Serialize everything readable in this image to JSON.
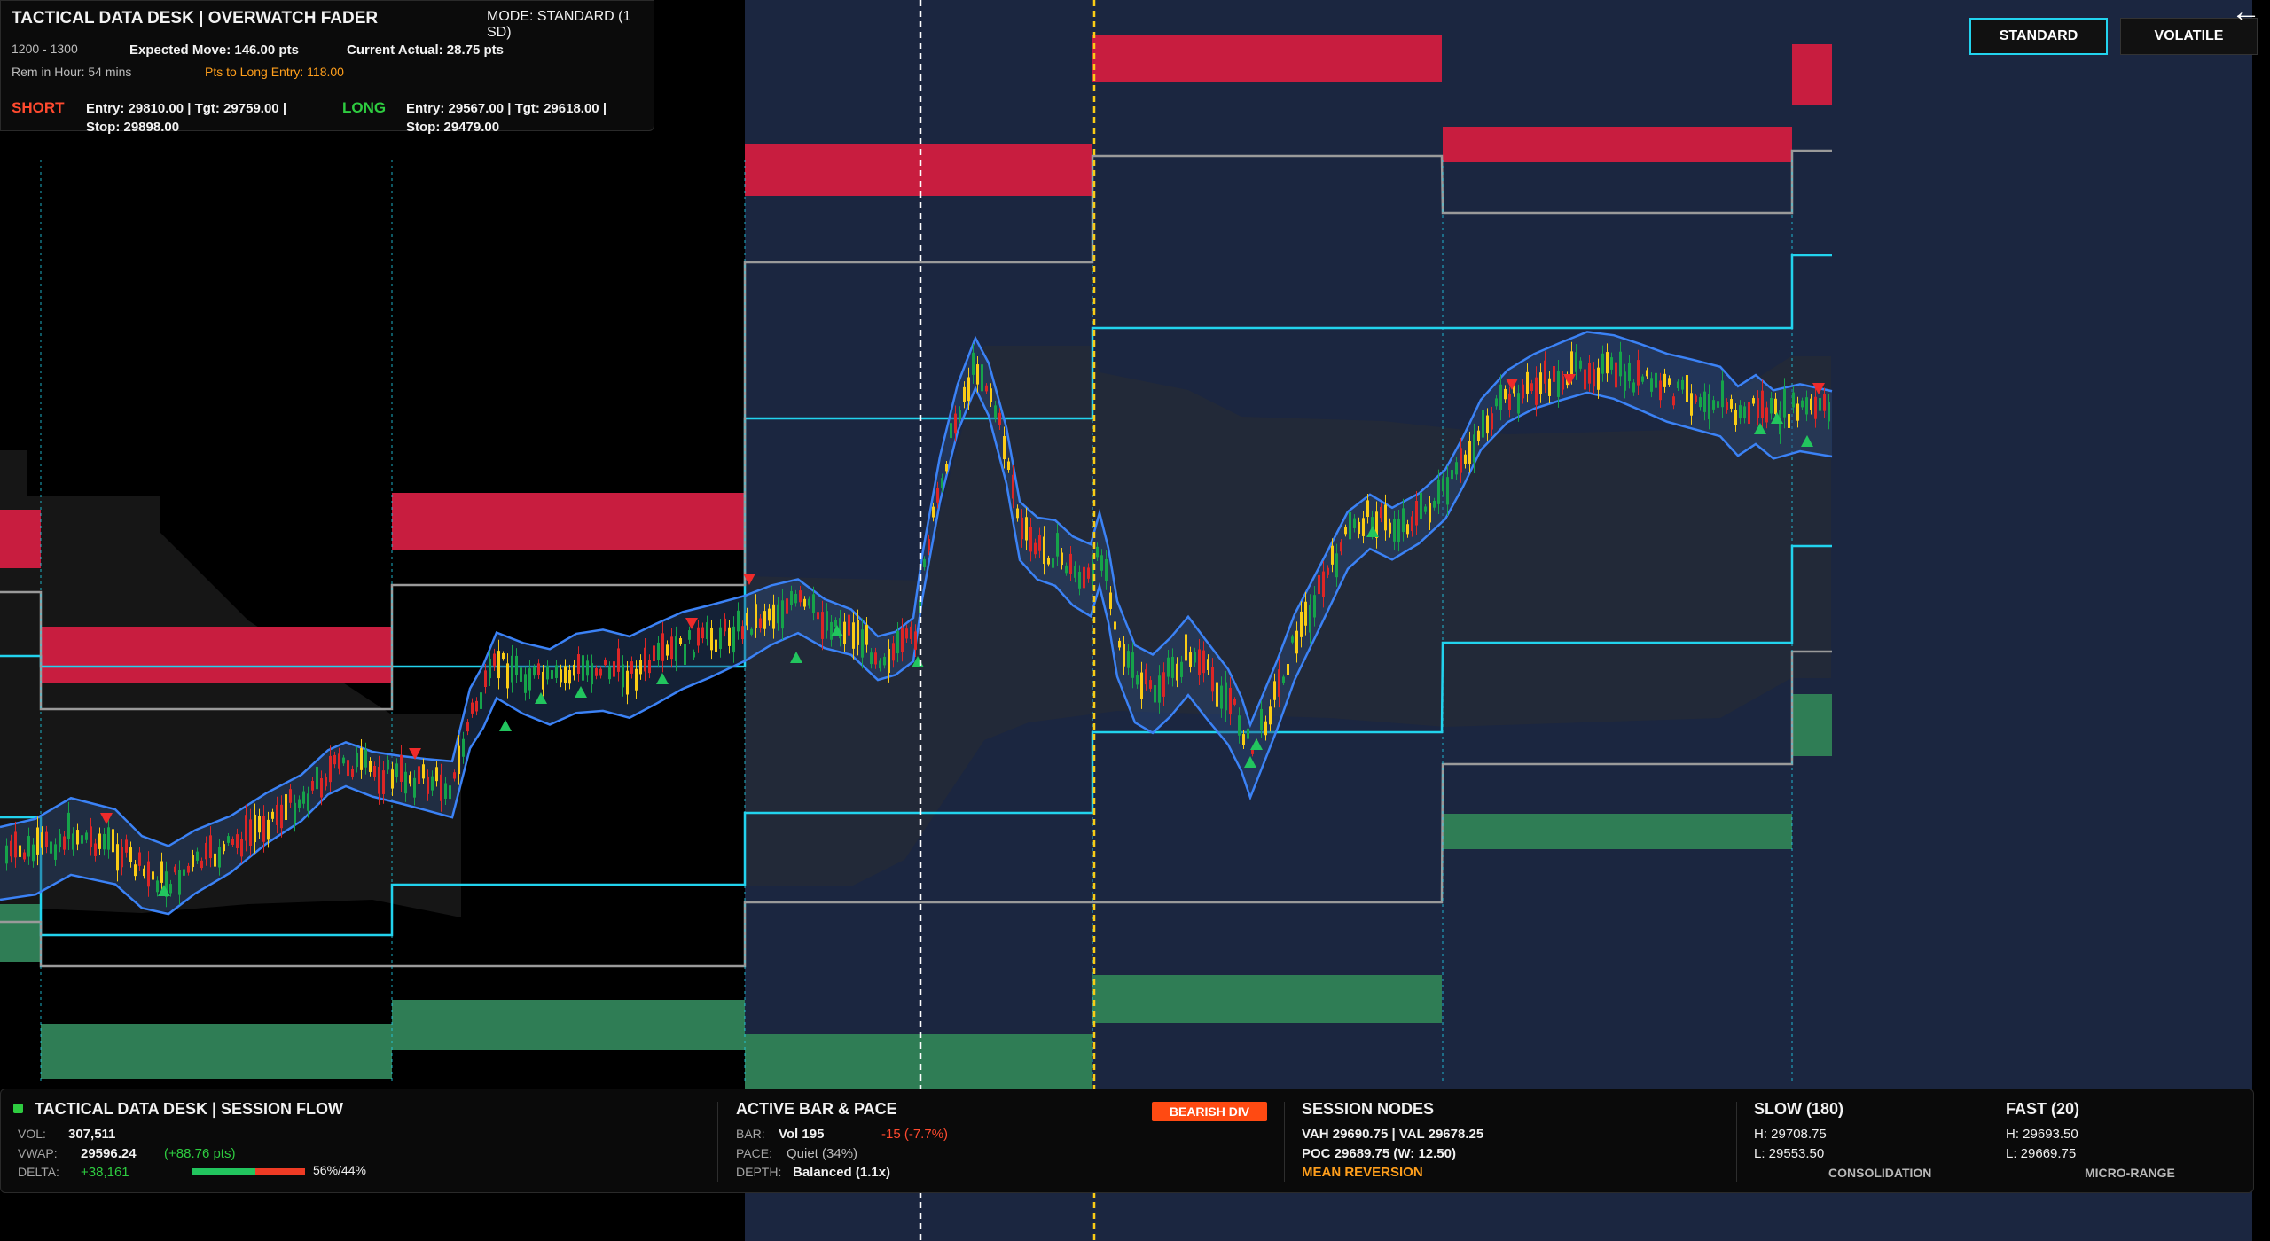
{
  "top_panel": {
    "title": "TACTICAL DATA DESK  |  OVERWATCH FADER",
    "mode": "MODE: STANDARD (1 SD)",
    "hour_range": "1200 - 1300",
    "expected_move": "Expected Move: 146.00 pts",
    "current_actual": "Current Actual: 28.75 pts",
    "remaining": "Rem in Hour: 54 mins",
    "pts_to_long": "Pts to Long Entry: 118.00",
    "short_label": "SHORT",
    "short_entry": "Entry: 29810.00  |  Tgt: 29759.00  |",
    "short_stop": "Stop: 29898.00",
    "long_label": "LONG",
    "long_entry": "Entry: 29567.00  |  Tgt: 29618.00  |",
    "long_stop": "Stop: 29479.00"
  },
  "mode_buttons": {
    "standard": "STANDARD",
    "volatile": "VOLATILE",
    "active": "STANDARD"
  },
  "back_icon": "arrow-left-icon",
  "bottom_panel": {
    "session_flow": {
      "title": "TACTICAL DATA DESK  |  SESSION FLOW",
      "vol_label": "VOL:",
      "vol_value": "307,511",
      "vwap_label": "VWAP:",
      "vwap_value": "29596.24",
      "vwap_change": "(+88.76 pts)",
      "delta_label": "DELTA:",
      "delta_value": "+38,161",
      "delta_split": "56%/44%",
      "delta_buy_fraction": 0.56
    },
    "active_bar": {
      "title": "ACTIVE BAR & PACE",
      "bar_label": "BAR:",
      "bar_vol": "Vol 195",
      "bar_change": "-15 (-7.7%)",
      "pace_label": "PACE:",
      "pace_value": "Quiet (34%)",
      "depth_label": "DEPTH:",
      "depth_value": "Balanced (1.1x)",
      "badge": "BEARISH DIV"
    },
    "session_nodes": {
      "title": "SESSION NODES",
      "vah_val": "VAH 29690.75  |  VAL 29678.25",
      "poc": "POC 29689.75 (W: 12.50)",
      "regime": "MEAN REVERSION"
    },
    "slow": {
      "title": "SLOW (180)",
      "high": "H: 29708.75",
      "low": "L: 29553.50",
      "state": "CONSOLIDATION"
    },
    "fast": {
      "title": "FAST (20)",
      "high": "H: 29693.50",
      "low": "L: 29669.75",
      "state": "MICRO-RANGE"
    }
  },
  "colors": {
    "background": "#000000",
    "session_shade": "#1b2640",
    "short_zone": "#c81d3f",
    "long_zone": "#2f7d55",
    "level_cyan": "#22d3ee",
    "level_gray": "#8a8a8a",
    "vwap_band": "#3b82f6",
    "candle_up": "#16a34a",
    "candle_down": "#dc2626",
    "candle_neutral": "#facc15",
    "marker_buy": "#22c55e",
    "marker_sell": "#ef2b2b",
    "divider_white": "#ffffff",
    "divider_yellow": "#facc15"
  }
}
